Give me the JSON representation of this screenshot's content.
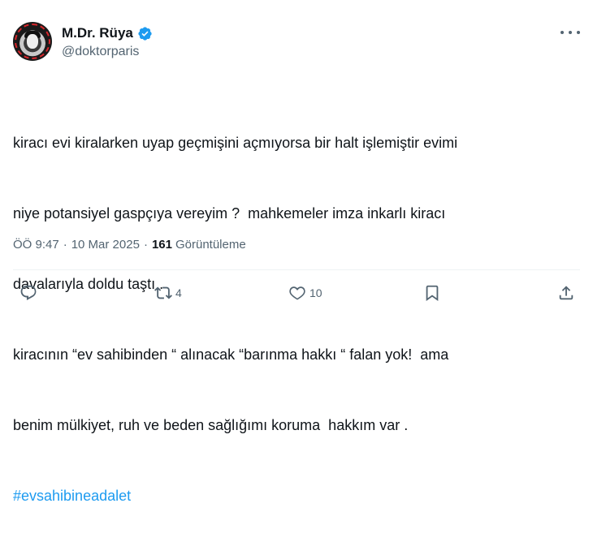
{
  "author": {
    "name": "M.Dr. Rüya",
    "handle": "@doktorparis",
    "verified_color": "#1d9bf0"
  },
  "tweet": {
    "lines": [
      "kiracı evi kiralarken uyap geçmişini açmıyorsa bir halt işlemiştir evimi",
      "niye potansiyel gaspçıya vereyim ?  mahkemeler imza inkarlı kiracı",
      "davalarıyla doldu taştı .",
      "kiracının “ev sahibinden “ alınacak “barınma hakkı “ falan yok!  ama",
      "benim mülkiyet, ruh ve beden sağlığımı koruma  hakkım var ."
    ],
    "hashtag": "#evsahibineadalet"
  },
  "meta": {
    "time": "ÖÖ 9:47",
    "separator": "·",
    "date": "10 Mar 2025",
    "views_count": "161",
    "views_label": "Görüntüleme"
  },
  "actions": {
    "reply_count": "",
    "retweet_count": "4",
    "like_count": "10"
  },
  "icons": {
    "reply": "reply-icon",
    "retweet": "retweet-icon",
    "like": "heart-icon",
    "bookmark": "bookmark-icon",
    "share": "share-icon",
    "more": "more-icon"
  }
}
